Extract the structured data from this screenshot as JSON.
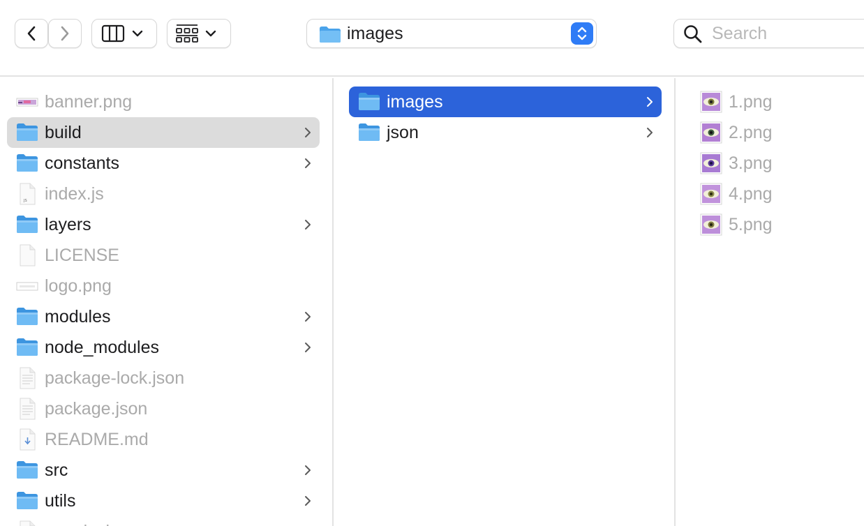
{
  "toolbar": {
    "path_label": "images",
    "search_placeholder": "Search"
  },
  "columns": [
    {
      "items": [
        {
          "name": "banner.png",
          "kind": "image",
          "dim": true
        },
        {
          "name": "build",
          "kind": "folder",
          "selected": "gray",
          "chevron": true
        },
        {
          "name": "constants",
          "kind": "folder",
          "chevron": true
        },
        {
          "name": "index.js",
          "kind": "js",
          "dim": true
        },
        {
          "name": "layers",
          "kind": "folder",
          "chevron": true
        },
        {
          "name": "LICENSE",
          "kind": "doc",
          "dim": true
        },
        {
          "name": "logo.png",
          "kind": "image-white",
          "dim": true
        },
        {
          "name": "modules",
          "kind": "folder",
          "chevron": true
        },
        {
          "name": "node_modules",
          "kind": "folder",
          "chevron": true
        },
        {
          "name": "package-lock.json",
          "kind": "text",
          "dim": true
        },
        {
          "name": "package.json",
          "kind": "text",
          "dim": true
        },
        {
          "name": "README.md",
          "kind": "md",
          "dim": true
        },
        {
          "name": "src",
          "kind": "folder",
          "chevron": true
        },
        {
          "name": "utils",
          "kind": "folder",
          "chevron": true
        },
        {
          "name": "yarn.lock",
          "kind": "text",
          "dim": true
        }
      ]
    },
    {
      "items": [
        {
          "name": "images",
          "kind": "folder",
          "selected": "blue",
          "chevron": true
        },
        {
          "name": "json",
          "kind": "folder",
          "chevron": true
        }
      ]
    },
    {
      "items": [
        {
          "name": "1.png",
          "kind": "thumb",
          "dim": true,
          "thumb": {
            "bg": "#b88ad8",
            "iris": "#7a7a3a",
            "pupil": "#1e1e1e"
          }
        },
        {
          "name": "2.png",
          "kind": "thumb",
          "dim": true,
          "thumb": {
            "bg": "#b27fd3",
            "iris": "#3d5a3d",
            "pupil": "#101010"
          }
        },
        {
          "name": "3.png",
          "kind": "thumb",
          "dim": true,
          "thumb": {
            "bg": "#a87bd3",
            "iris": "#5a3a9a",
            "pupil": "#1a1040"
          }
        },
        {
          "name": "4.png",
          "kind": "thumb",
          "dim": true,
          "thumb": {
            "bg": "#c193dc",
            "iris": "#8a8a4a",
            "pupil": "#2a2a10"
          }
        },
        {
          "name": "5.png",
          "kind": "thumb",
          "dim": true,
          "thumb": {
            "bg": "#bd8fda",
            "iris": "#7f7a40",
            "pupil": "#222210"
          }
        }
      ]
    }
  ],
  "colors": {
    "accent": "#2c63da",
    "selection_gray": "#dcdcdc",
    "folder": "#5cb0f0",
    "stepper": "#2f7cf6"
  }
}
